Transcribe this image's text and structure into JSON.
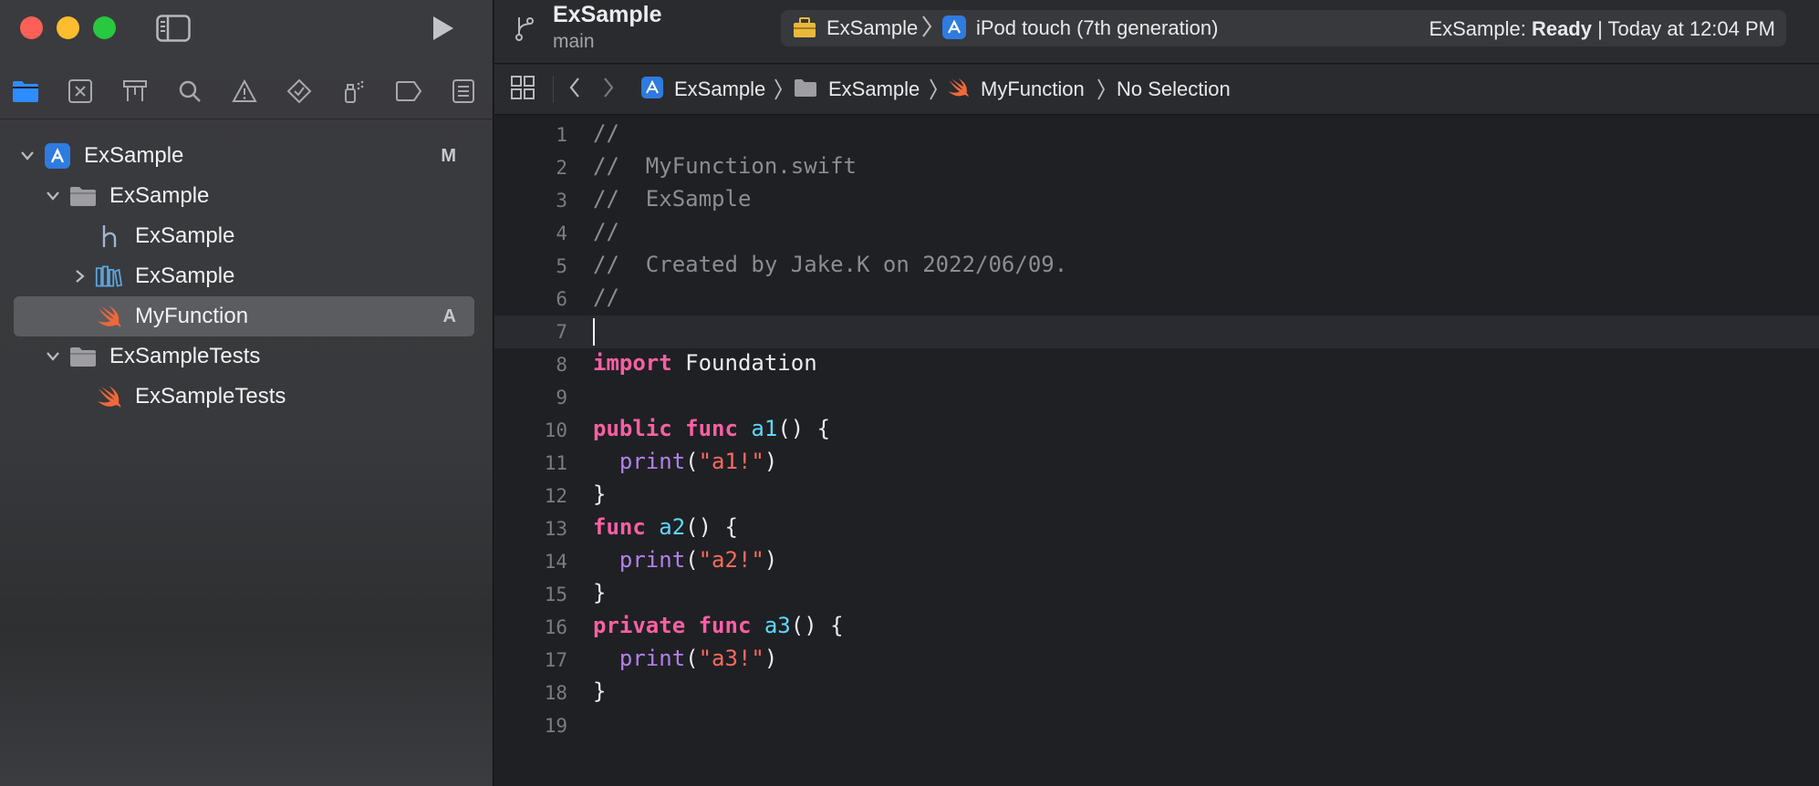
{
  "window": {
    "project_title": "ExSample",
    "branch": "main",
    "scheme_target": "ExSample",
    "destination": "iPod touch (7th generation)",
    "status_project": "ExSample:",
    "status_state": "Ready",
    "status_time": "| Today at 12:04 PM"
  },
  "navigator_icons": [
    "folder-icon",
    "source-control-icon",
    "symbol-icon",
    "find-icon",
    "issue-icon",
    "test-icon",
    "debug-icon",
    "breakpoint-icon",
    "report-icon"
  ],
  "tree": [
    {
      "label": "ExSample",
      "badge": "M",
      "kind": "project",
      "expanded": true
    },
    {
      "label": "ExSample",
      "badge": "",
      "kind": "folder",
      "expanded": true
    },
    {
      "label": "ExSample",
      "badge": "",
      "kind": "header"
    },
    {
      "label": "ExSample",
      "badge": "",
      "kind": "library",
      "expanded": false
    },
    {
      "label": "MyFunction",
      "badge": "A",
      "kind": "swift",
      "selected": true
    },
    {
      "label": "ExSampleTests",
      "badge": "",
      "kind": "folder",
      "expanded": true
    },
    {
      "label": "ExSampleTests",
      "badge": "",
      "kind": "swift"
    }
  ],
  "jumpbar": {
    "project": "ExSample",
    "group": "ExSample",
    "file": "MyFunction",
    "symbol": "No Selection"
  },
  "editor": {
    "line_numbers": [
      "1",
      "2",
      "3",
      "4",
      "5",
      "6",
      "7",
      "8",
      "9",
      "10",
      "11",
      "12",
      "13",
      "14",
      "15",
      "16",
      "17",
      "18",
      "19"
    ],
    "lines": [
      [
        {
          "t": "//",
          "c": "cmt"
        }
      ],
      [
        {
          "t": "//  MyFunction.swift",
          "c": "cmt"
        }
      ],
      [
        {
          "t": "//  ExSample",
          "c": "cmt"
        }
      ],
      [
        {
          "t": "//",
          "c": "cmt"
        }
      ],
      [
        {
          "t": "//  Created by Jake.K on 2022/06/09.",
          "c": "cmt"
        }
      ],
      [
        {
          "t": "//",
          "c": "cmt"
        }
      ],
      [],
      [
        {
          "t": "import",
          "c": "kw"
        },
        {
          "t": " Foundation",
          "c": "plain"
        }
      ],
      [],
      [
        {
          "t": "public",
          "c": "kw"
        },
        {
          "t": " ",
          "c": "plain"
        },
        {
          "t": "func",
          "c": "kw"
        },
        {
          "t": " ",
          "c": "plain"
        },
        {
          "t": "a1",
          "c": "fn"
        },
        {
          "t": "() {",
          "c": "plain"
        }
      ],
      [
        {
          "t": "  ",
          "c": "plain"
        },
        {
          "t": "print",
          "c": "call"
        },
        {
          "t": "(",
          "c": "plain"
        },
        {
          "t": "\"a1!\"",
          "c": "str"
        },
        {
          "t": ")",
          "c": "plain"
        }
      ],
      [
        {
          "t": "}",
          "c": "plain"
        }
      ],
      [
        {
          "t": "func",
          "c": "kw"
        },
        {
          "t": " ",
          "c": "plain"
        },
        {
          "t": "a2",
          "c": "fn"
        },
        {
          "t": "() {",
          "c": "plain"
        }
      ],
      [
        {
          "t": "  ",
          "c": "plain"
        },
        {
          "t": "print",
          "c": "call"
        },
        {
          "t": "(",
          "c": "plain"
        },
        {
          "t": "\"a2!\"",
          "c": "str"
        },
        {
          "t": ")",
          "c": "plain"
        }
      ],
      [
        {
          "t": "}",
          "c": "plain"
        }
      ],
      [
        {
          "t": "private",
          "c": "kw"
        },
        {
          "t": " ",
          "c": "plain"
        },
        {
          "t": "func",
          "c": "kw"
        },
        {
          "t": " ",
          "c": "plain"
        },
        {
          "t": "a3",
          "c": "fn"
        },
        {
          "t": "() {",
          "c": "plain"
        }
      ],
      [
        {
          "t": "  ",
          "c": "plain"
        },
        {
          "t": "print",
          "c": "call"
        },
        {
          "t": "(",
          "c": "plain"
        },
        {
          "t": "\"a3!\"",
          "c": "str"
        },
        {
          "t": ")",
          "c": "plain"
        }
      ],
      [
        {
          "t": "}",
          "c": "plain"
        }
      ],
      []
    ]
  }
}
